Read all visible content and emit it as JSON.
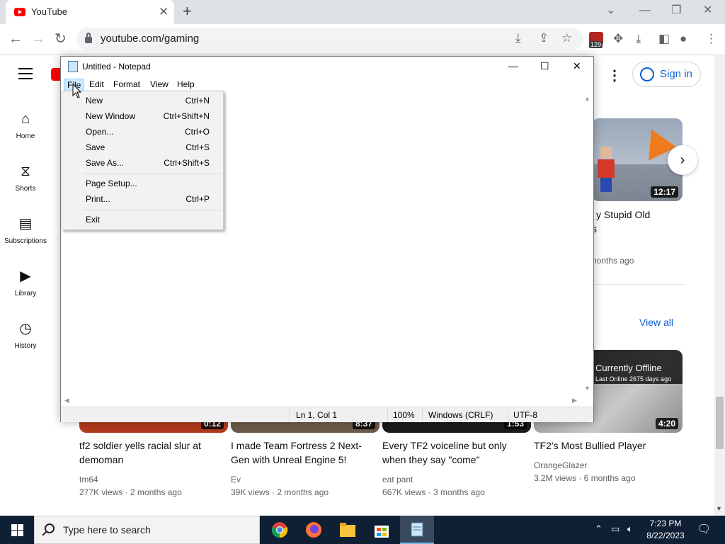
{
  "browser": {
    "tab_title": "YouTube",
    "url": "youtube.com/gaming",
    "extension_badge": "129"
  },
  "youtube": {
    "sidebar": [
      {
        "label": "Home",
        "icon": "home-icon"
      },
      {
        "label": "Shorts",
        "icon": "shorts-icon"
      },
      {
        "label": "Subscriptions",
        "icon": "subscriptions-icon"
      },
      {
        "label": "Library",
        "icon": "library-icon"
      },
      {
        "label": "History",
        "icon": "history-icon"
      }
    ],
    "sign_in": "Sign in",
    "view_all": "View all",
    "row1_video": {
      "duration": "12:17",
      "title_fragment_1": "y Stupid Old",
      "title_fragment_2": "s",
      "meta_fragment": "nonths ago"
    },
    "row2_right_thumb": {
      "overlay_title": "Currently Offline",
      "overlay_sub": "Last Online 2675 days ago",
      "duration": "4:20"
    },
    "videos": [
      {
        "duration": "0:12",
        "title": "tf2 soldier yells racial slur at demoman",
        "channel": "tm64",
        "meta": "277K views · 2 months ago"
      },
      {
        "duration": "8:37",
        "title": "I made Team Fortress 2 Next-Gen with Unreal Engine 5!",
        "channel": "Ev",
        "meta": "39K views · 2 months ago"
      },
      {
        "duration": "1:53",
        "title": "Every TF2 voiceline but only when they say \"come\"",
        "channel": "eat pant",
        "meta": "667K views · 3 months ago"
      },
      {
        "duration": "4:20",
        "title": "TF2's Most Bullied Player",
        "channel": "OrangeGlazer",
        "meta": "3.2M views · 6 months ago"
      }
    ]
  },
  "notepad": {
    "title": "Untitled - Notepad",
    "menus": [
      "File",
      "Edit",
      "Format",
      "View",
      "Help"
    ],
    "status": {
      "position": "Ln 1, Col 1",
      "zoom": "100%",
      "line_ending": "Windows (CRLF)",
      "encoding": "UTF-8"
    },
    "file_menu": [
      {
        "label": "New",
        "shortcut": "Ctrl+N"
      },
      {
        "label": "New Window",
        "shortcut": "Ctrl+Shift+N"
      },
      {
        "label": "Open...",
        "shortcut": "Ctrl+O"
      },
      {
        "label": "Save",
        "shortcut": "Ctrl+S"
      },
      {
        "label": "Save As...",
        "shortcut": "Ctrl+Shift+S"
      },
      {
        "label": "Page Setup...",
        "shortcut": ""
      },
      {
        "label": "Print...",
        "shortcut": "Ctrl+P"
      },
      {
        "label": "Exit",
        "shortcut": ""
      }
    ]
  },
  "taskbar": {
    "search_placeholder": "Type here to search",
    "time": "7:23 PM",
    "date": "8/22/2023"
  }
}
